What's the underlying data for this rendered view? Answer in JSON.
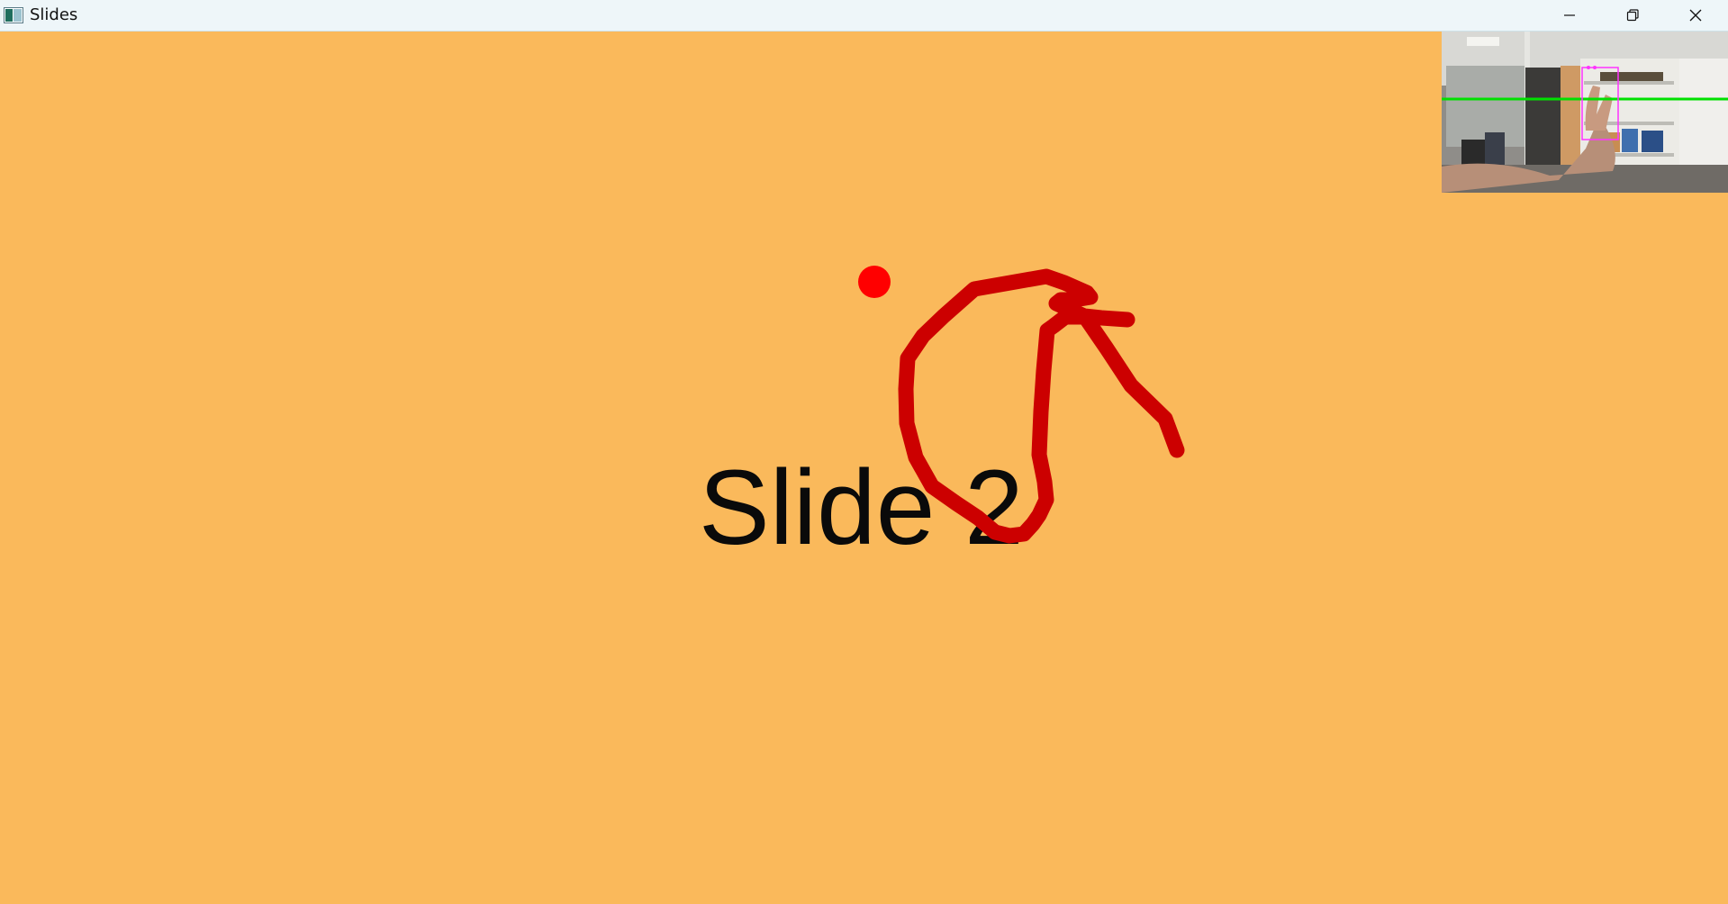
{
  "window": {
    "title": "Slides",
    "controls": {
      "minimize_icon": "minimize-icon",
      "restore_icon": "restore-icon",
      "close_icon": "close-icon"
    }
  },
  "slide": {
    "title": "Slide 2",
    "background_color": "#fab95b",
    "text_color": "#0a0a0a"
  },
  "annotation": {
    "stroke_color": "#cc0000",
    "pointer_color": "#ff0000"
  },
  "webcam": {
    "icon": "camera-feed",
    "overlay_line_color": "#00e000",
    "tracking_box_color": "#ff33ff"
  }
}
